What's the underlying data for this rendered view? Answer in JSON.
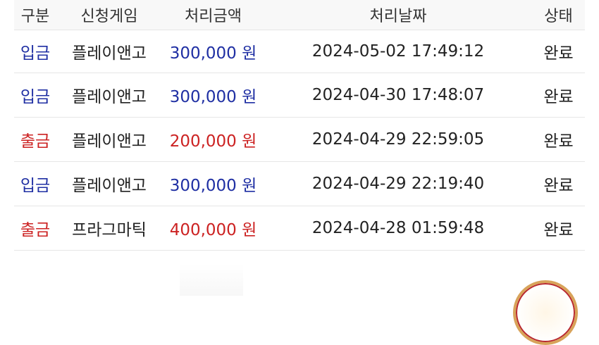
{
  "table": {
    "headers": [
      "구분",
      "신청게임",
      "처리금액",
      "처리날짜",
      "상태"
    ],
    "rows": [
      {
        "type": "입금",
        "kind": "deposit",
        "game": "플레이앤고",
        "amount": "300,000 원",
        "date": "2024-05-02 17:49:12",
        "status": "완료"
      },
      {
        "type": "입금",
        "kind": "deposit",
        "game": "플레이앤고",
        "amount": "300,000 원",
        "date": "2024-04-30 17:48:07",
        "status": "완료"
      },
      {
        "type": "출금",
        "kind": "withdraw",
        "game": "플레이앤고",
        "amount": "200,000 원",
        "date": "2024-04-29 22:59:05",
        "status": "완료"
      },
      {
        "type": "입금",
        "kind": "deposit",
        "game": "플레이앤고",
        "amount": "300,000 원",
        "date": "2024-04-29 22:19:40",
        "status": "완료"
      },
      {
        "type": "출금",
        "kind": "withdraw",
        "game": "프라그마틱",
        "amount": "400,000 원",
        "date": "2024-04-28 01:59:48",
        "status": "완료"
      }
    ]
  },
  "colors": {
    "deposit": "#1f2fa3",
    "withdraw": "#cc2222"
  }
}
